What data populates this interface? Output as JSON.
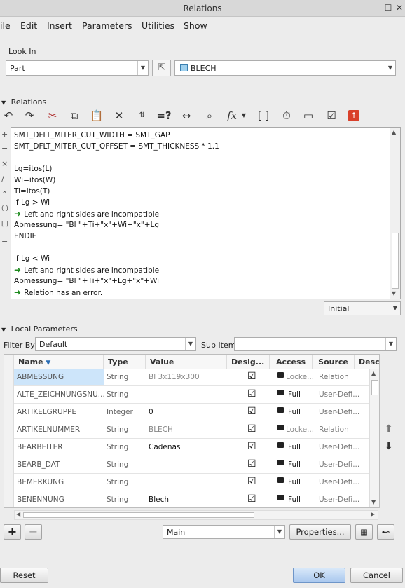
{
  "window": {
    "title": "Relations"
  },
  "menu": [
    "ile",
    "Edit",
    "Insert",
    "Parameters",
    "Utilities",
    "Show"
  ],
  "lookin": {
    "label": "Look In",
    "type_value": "Part",
    "model_value": "BLECH"
  },
  "relations": {
    "label": "Relations",
    "lines": [
      "SMT_DFLT_MITER_CUT_WIDTH = SMT_GAP",
      "SMT_DFLT_MITER_CUT_OFFSET = SMT_THICKNESS * 1.1",
      "",
      "Lg=itos(L)",
      "Wi=itos(W)",
      "Ti=itos(T)",
      "if Lg > Wi",
      "",
      "Abmessung= \"Bl \"+Ti+\"x\"+Wi+\"x\"+Lg",
      "ENDIF",
      "",
      "if Lg < Wi",
      "",
      "Abmessung= \"Bl \"+Ti+\"x\"+Lg+\"x\"+Wi",
      ""
    ],
    "messages": {
      "incompatible1": "Left and right sides are incompatible",
      "incompatible2": "Left and right sides are incompatible",
      "error": "Relation has an error."
    },
    "initial": "Initial"
  },
  "local_params": {
    "label": "Local Parameters",
    "filter_label": "Filter By",
    "filter_value": "Default",
    "subitems_label": "Sub Items",
    "columns": [
      "Name",
      "Type",
      "Value",
      "Desig...",
      "Access",
      "Source",
      "Desc"
    ],
    "rows": [
      {
        "name": "ABMESSUNG",
        "type": "String",
        "value": "Bl 3x119x300",
        "access": "Locke...",
        "source": "Relation"
      },
      {
        "name": "ALTE_ZEICHNUNGSNU...",
        "type": "String",
        "value": "",
        "access": "Full",
        "source": "User-Defi..."
      },
      {
        "name": "ARTIKELGRUPPE",
        "type": "Integer",
        "value": "0",
        "access": "Full",
        "source": "User-Defi..."
      },
      {
        "name": "ARTIKELNUMMER",
        "type": "String",
        "value": "BLECH",
        "access": "Locke...",
        "source": "Relation"
      },
      {
        "name": "BEARBEITER",
        "type": "String",
        "value": "Cadenas",
        "access": "Full",
        "source": "User-Defi..."
      },
      {
        "name": "BEARB_DAT",
        "type": "String",
        "value": "",
        "access": "Full",
        "source": "User-Defi..."
      },
      {
        "name": "BEMERKUNG",
        "type": "String",
        "value": "",
        "access": "Full",
        "source": "User-Defi..."
      },
      {
        "name": "BENENNUNG",
        "type": "String",
        "value": "Blech",
        "access": "Full",
        "source": "User-Defi..."
      }
    ],
    "view_value": "Main",
    "properties_label": "Properties..."
  },
  "footer": {
    "reset": "Reset",
    "ok": "OK",
    "cancel": "Cancel"
  }
}
